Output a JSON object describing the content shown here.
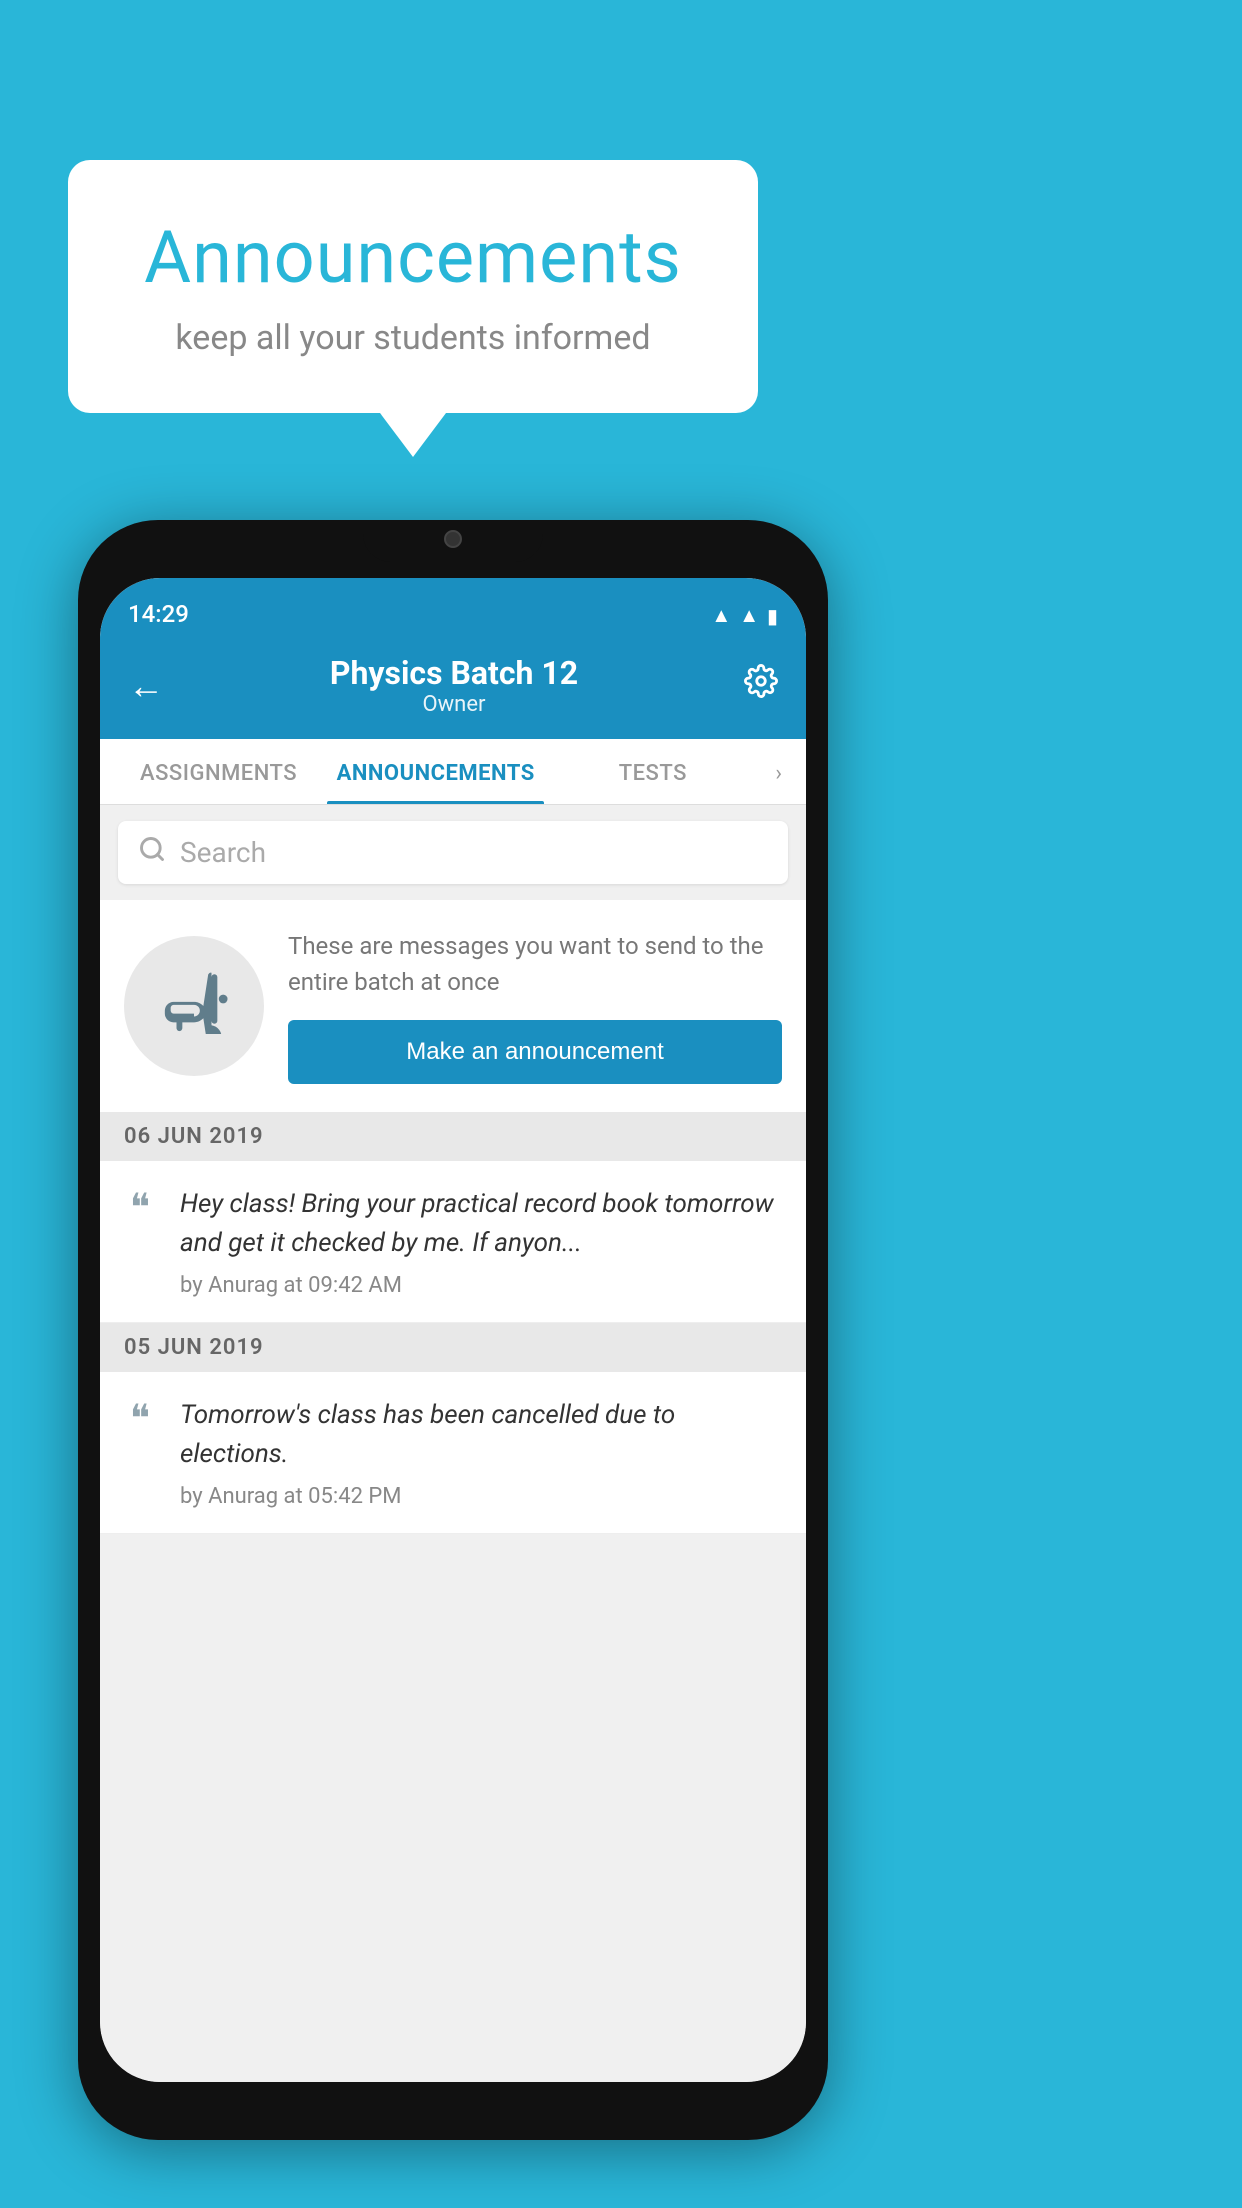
{
  "bubble": {
    "title": "Announcements",
    "subtitle": "keep all your students informed"
  },
  "appBar": {
    "title": "Physics Batch 12",
    "subtitle": "Owner",
    "backLabel": "←",
    "settingsLabel": "⚙"
  },
  "tabs": [
    {
      "label": "ASSIGNMENTS",
      "active": false
    },
    {
      "label": "ANNOUNCEMENTS",
      "active": true
    },
    {
      "label": "TESTS",
      "active": false
    }
  ],
  "search": {
    "placeholder": "Search"
  },
  "promo": {
    "description": "These are messages you want to send to the entire batch at once",
    "buttonLabel": "Make an announcement"
  },
  "announcements": [
    {
      "date": "06  JUN  2019",
      "text": "Hey class! Bring your practical record book tomorrow and get it checked by me. If anyon...",
      "meta": "by Anurag at 09:42 AM"
    },
    {
      "date": "05  JUN  2019",
      "text": "Tomorrow's class has been cancelled due to elections.",
      "meta": "by Anurag at 05:42 PM"
    }
  ],
  "statusBar": {
    "time": "14:29"
  }
}
